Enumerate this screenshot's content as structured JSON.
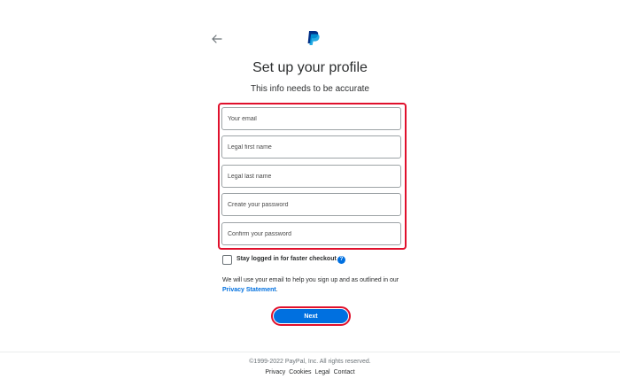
{
  "header": {
    "back_icon": "arrow-left-icon",
    "logo": "paypal-logo",
    "title": "Set up your profile",
    "subtitle": "This info needs to be accurate"
  },
  "form": {
    "fields": [
      {
        "placeholder": "Your email",
        "value": ""
      },
      {
        "placeholder": "Legal first name",
        "value": ""
      },
      {
        "placeholder": "Legal last name",
        "value": ""
      },
      {
        "placeholder": "Create your password",
        "value": ""
      },
      {
        "placeholder": "Confirm your password",
        "value": ""
      }
    ],
    "stay_logged_in_label": "Stay logged in for faster checkout",
    "stay_logged_in_checked": false,
    "help_icon": "question-circle-icon",
    "help_glyph": "?",
    "notice_text": "We will use your email to help you sign up and as outlined in our ",
    "privacy_link": "Privacy Statement",
    "notice_end": ".",
    "next_label": "Next"
  },
  "footer": {
    "copyright": "©1999-2022 PayPal, Inc. All rights reserved.",
    "links": [
      "Privacy",
      "Cookies",
      "Legal",
      "Contact"
    ]
  },
  "colors": {
    "accent": "#0070e0",
    "highlight": "#e0102c",
    "logo_dark": "#003087",
    "logo_light": "#009cde"
  }
}
